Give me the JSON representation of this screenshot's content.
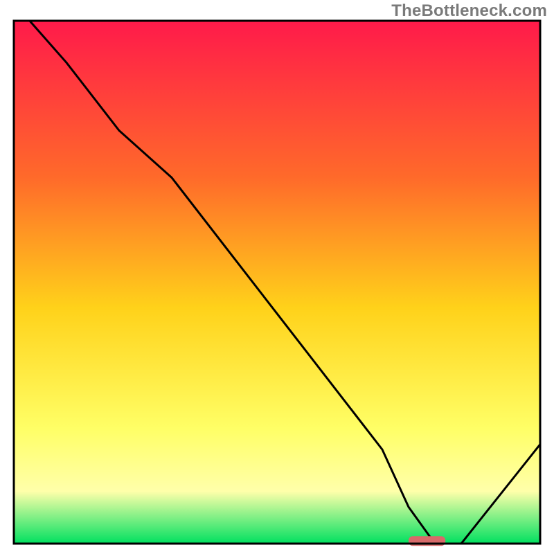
{
  "watermark": "TheBottleneck.com",
  "colors": {
    "gradient_top": "#ff1a4a",
    "gradient_mid1": "#ff6a2a",
    "gradient_mid2": "#ffd21a",
    "gradient_mid3": "#ffff66",
    "gradient_mid4": "#ffffaa",
    "gradient_bottom": "#00e060",
    "curve": "#000000",
    "border": "#000000",
    "marker": "#d86a6a"
  },
  "chart_data": {
    "type": "line",
    "title": "",
    "xlabel": "",
    "ylabel": "",
    "xlim": [
      0,
      100
    ],
    "ylim": [
      0,
      100
    ],
    "series": [
      {
        "name": "bottleneck_curve",
        "x": [
          3,
          10,
          20,
          30,
          40,
          50,
          60,
          70,
          75,
          80,
          85,
          100
        ],
        "values": [
          100,
          92,
          79,
          70,
          57,
          44,
          31,
          18,
          7,
          0,
          0,
          19
        ]
      }
    ],
    "marker": {
      "x_start": 75,
      "x_end": 82,
      "y": 0.5
    },
    "background_gradient_stops": [
      {
        "pct": 0,
        "color": "#ff1a4a"
      },
      {
        "pct": 30,
        "color": "#ff6a2a"
      },
      {
        "pct": 55,
        "color": "#ffd21a"
      },
      {
        "pct": 78,
        "color": "#ffff66"
      },
      {
        "pct": 90,
        "color": "#ffffaa"
      },
      {
        "pct": 100,
        "color": "#00e060"
      }
    ]
  }
}
